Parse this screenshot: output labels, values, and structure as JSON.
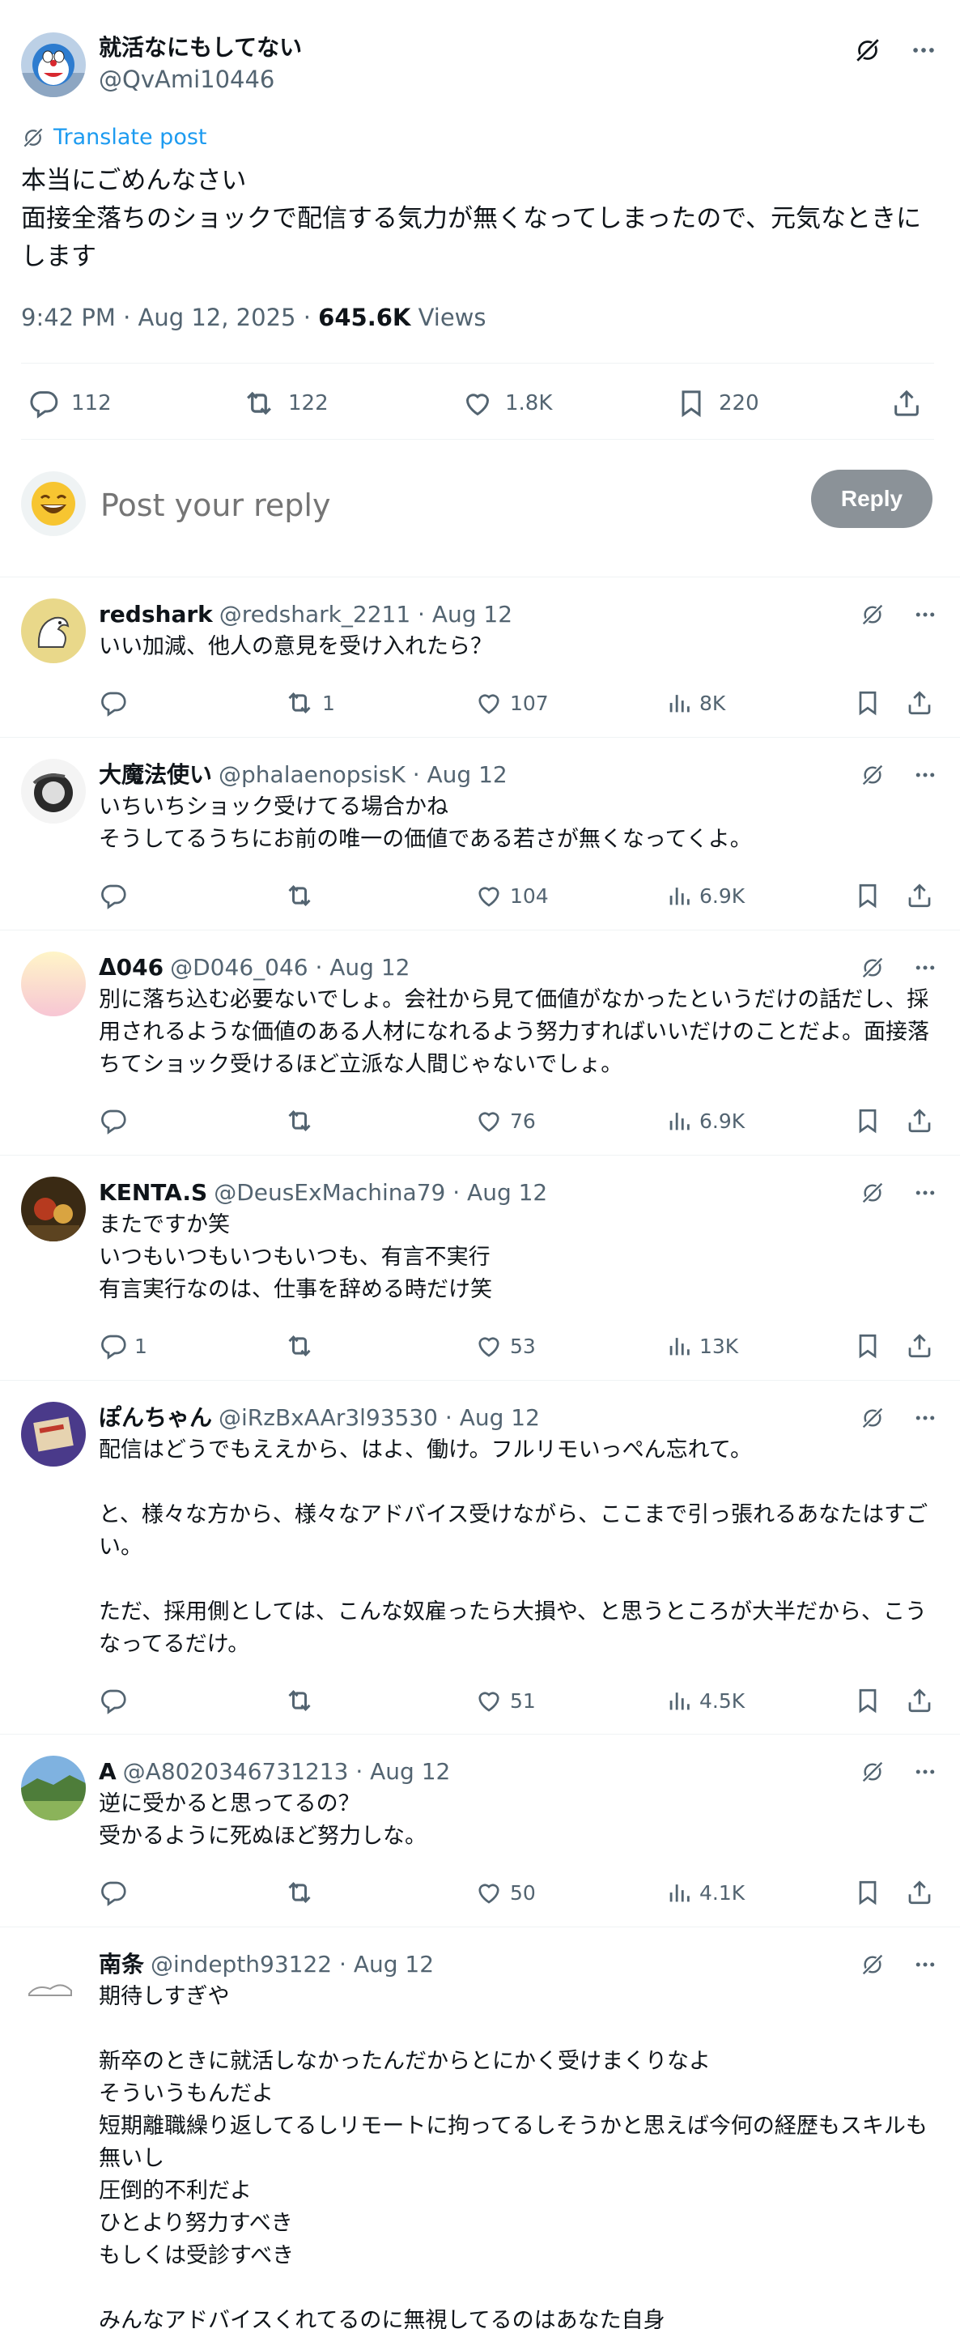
{
  "post": {
    "display_name": "就活なにもしてない",
    "handle": "@QvAmi10446",
    "translate_label": "Translate post",
    "body_lines": [
      "本当にごめんなさい",
      "面接全落ちのショックで配信する気力が無くなってしまったので、元気なときにします"
    ],
    "time": "9:42 PM · Aug 12, 2025 · ",
    "views_count": "645.6K",
    "views_label": " Views",
    "stats": {
      "replies": "112",
      "reposts": "122",
      "likes": "1.8K",
      "bookmarks": "220"
    }
  },
  "composer": {
    "placeholder": "Post your reply",
    "button_label": "Reply"
  },
  "replies": [
    {
      "name": "redshark",
      "meta": "@redshark_2211 · Aug 12",
      "text": "いい加減、他人の意見を受け入れたら？",
      "replies": "",
      "reposts": "1",
      "likes": "107",
      "views": "8K"
    },
    {
      "name": "大魔法使い",
      "meta": "@phalaenopsisK · Aug 12",
      "text": "いちいちショック受けてる場合かね\nそうしてるうちにお前の唯一の価値である若さが無くなってくよ。",
      "replies": "",
      "reposts": "",
      "likes": "104",
      "views": "6.9K"
    },
    {
      "name": "Δ046",
      "meta": "@D046_046 · Aug 12",
      "text": "別に落ち込む必要ないでしょ。会社から見て価値がなかったというだけの話だし、採用されるような価値のある人材になれるよう努力すればいいだけのことだよ。面接落ちてショック受けるほど立派な人間じゃないでしょ。",
      "replies": "",
      "reposts": "",
      "likes": "76",
      "views": "6.9K"
    },
    {
      "name": "KENTA.S",
      "meta": "@DeusExMachina79 · Aug 12",
      "text": "またですか笑\nいつもいつもいつもいつも、有言不実行\n有言実行なのは、仕事を辞める時だけ笑",
      "replies": "1",
      "reposts": "",
      "likes": "53",
      "views": "13K"
    },
    {
      "name": "ぽんちゃん",
      "meta": "@iRzBxAAr3l93530 · Aug 12",
      "text": "配信はどうでもええから、はよ、働け。フルリモいっぺん忘れて。\n\nと、様々な方から、様々なアドバイス受けながら、ここまで引っ張れるあなたはすごい。\n\nただ、採用側としては、こんな奴雇ったら大損や、と思うところが大半だから、こうなってるだけ。",
      "replies": "",
      "reposts": "",
      "likes": "51",
      "views": "4.5K"
    },
    {
      "name": "A",
      "meta": "@A8020346731213 · Aug 12",
      "text": "逆に受かると思ってるの？\n受かるように死ぬほど努力しな。",
      "replies": "",
      "reposts": "",
      "likes": "50",
      "views": "4.1K"
    },
    {
      "name": "南条",
      "meta": "@indepth93122 · Aug 12",
      "text": "期待しすぎや\n\n新卒のときに就活しなかったんだからとにかく受けまくりなよ\nそういうもんだよ\n短期離職繰り返してるしリモートに拘ってるしそうかと思えば今何の経歴もスキルも無いし\n圧倒的不利だよ\nひとより努力すべき\nもしくは受診すべき\n\nみんなアドバイスくれてるのに無視してるのはあなた自身",
      "replies": "",
      "reposts": "",
      "likes": "",
      "views": ""
    }
  ]
}
